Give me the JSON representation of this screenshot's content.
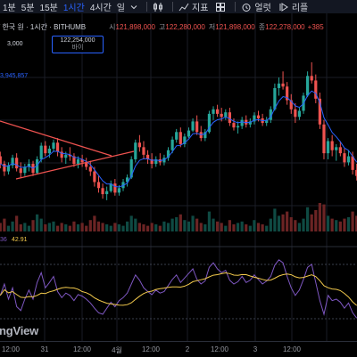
{
  "toolbar": {
    "timeframes": [
      {
        "label": "1분",
        "active": false
      },
      {
        "label": "5분",
        "active": false
      },
      {
        "label": "15분",
        "active": false
      },
      {
        "label": "1시간",
        "active": true
      },
      {
        "label": "4시간",
        "active": false
      },
      {
        "label": "일",
        "active": false
      }
    ],
    "indicators_label": "지표",
    "alert_label": "얼럿",
    "replay_label": "리플"
  },
  "symbol": {
    "title": "/ 한국 원 · 1시간 · BITHUMB",
    "open_label": "시",
    "open_value": "121,898,000",
    "high_label": "고",
    "high_value": "122,280,000",
    "low_label": "저",
    "low_value": "121,898,000",
    "close_label": "종",
    "close_value": "122,278,000",
    "change_value": "+385"
  },
  "order": {
    "price": "122,254,000",
    "side_label": "바이",
    "left_value": "3,000"
  },
  "price_tag": "3,945,857",
  "rsi": {
    "value_a": "36",
    "value_b": "42.91"
  },
  "watermark": "ngView",
  "time_axis": [
    "12:00",
    "31",
    "12:00",
    "4월",
    "12:00",
    "2",
    "12:00",
    "3",
    "12:00"
  ],
  "colors": {
    "up": "#26a69a",
    "down": "#ef5350",
    "accent": "#2962ff",
    "rsi_line": "#7e57c2",
    "rsi_ma": "#f2c94c"
  },
  "chart_data": {
    "type": "candlestick",
    "candles": [
      [
        0.6,
        0.63,
        0.52,
        0.55
      ],
      [
        0.55,
        0.57,
        0.47,
        0.5
      ],
      [
        0.5,
        0.56,
        0.48,
        0.54
      ],
      [
        0.54,
        0.61,
        0.52,
        0.59
      ],
      [
        0.59,
        0.62,
        0.5,
        0.52
      ],
      [
        0.52,
        0.56,
        0.46,
        0.49
      ],
      [
        0.49,
        0.55,
        0.47,
        0.53
      ],
      [
        0.53,
        0.58,
        0.5,
        0.55
      ],
      [
        0.55,
        0.57,
        0.47,
        0.49
      ],
      [
        0.49,
        0.6,
        0.48,
        0.58
      ],
      [
        0.58,
        0.69,
        0.56,
        0.67
      ],
      [
        0.67,
        0.7,
        0.6,
        0.62
      ],
      [
        0.62,
        0.67,
        0.59,
        0.65
      ],
      [
        0.65,
        0.71,
        0.63,
        0.69
      ],
      [
        0.69,
        0.72,
        0.6,
        0.63
      ],
      [
        0.63,
        0.66,
        0.56,
        0.59
      ],
      [
        0.59,
        0.63,
        0.55,
        0.61
      ],
      [
        0.61,
        0.66,
        0.57,
        0.6
      ],
      [
        0.6,
        0.62,
        0.53,
        0.55
      ],
      [
        0.55,
        0.6,
        0.52,
        0.58
      ],
      [
        0.58,
        0.61,
        0.53,
        0.56
      ],
      [
        0.56,
        0.59,
        0.51,
        0.53
      ],
      [
        0.53,
        0.57,
        0.47,
        0.5
      ],
      [
        0.5,
        0.53,
        0.4,
        0.43
      ],
      [
        0.43,
        0.47,
        0.36,
        0.39
      ],
      [
        0.39,
        0.42,
        0.32,
        0.35
      ],
      [
        0.35,
        0.4,
        0.31,
        0.37
      ],
      [
        0.37,
        0.44,
        0.36,
        0.42
      ],
      [
        0.42,
        0.45,
        0.34,
        0.36
      ],
      [
        0.36,
        0.41,
        0.34,
        0.39
      ],
      [
        0.39,
        0.45,
        0.37,
        0.43
      ],
      [
        0.43,
        0.48,
        0.4,
        0.46
      ],
      [
        0.46,
        0.6,
        0.45,
        0.58
      ],
      [
        0.58,
        0.71,
        0.56,
        0.69
      ],
      [
        0.69,
        0.74,
        0.63,
        0.66
      ],
      [
        0.66,
        0.7,
        0.58,
        0.61
      ],
      [
        0.61,
        0.64,
        0.55,
        0.58
      ],
      [
        0.58,
        0.62,
        0.52,
        0.55
      ],
      [
        0.55,
        0.6,
        0.53,
        0.58
      ],
      [
        0.58,
        0.62,
        0.54,
        0.56
      ],
      [
        0.56,
        0.61,
        0.54,
        0.59
      ],
      [
        0.59,
        0.66,
        0.57,
        0.64
      ],
      [
        0.64,
        0.73,
        0.62,
        0.71
      ],
      [
        0.71,
        0.78,
        0.69,
        0.76
      ],
      [
        0.76,
        0.79,
        0.66,
        0.68
      ],
      [
        0.68,
        0.75,
        0.66,
        0.73
      ],
      [
        0.73,
        0.79,
        0.72,
        0.77
      ],
      [
        0.77,
        0.85,
        0.76,
        0.83
      ],
      [
        0.83,
        0.87,
        0.74,
        0.76
      ],
      [
        0.76,
        0.8,
        0.7,
        0.72
      ],
      [
        0.72,
        0.78,
        0.7,
        0.76
      ],
      [
        0.76,
        0.9,
        0.75,
        0.88
      ],
      [
        0.88,
        0.93,
        0.84,
        0.91
      ],
      [
        0.91,
        0.94,
        0.86,
        0.88
      ],
      [
        0.88,
        0.92,
        0.83,
        0.86
      ],
      [
        0.86,
        0.91,
        0.84,
        0.89
      ],
      [
        0.89,
        0.92,
        0.8,
        0.82
      ],
      [
        0.82,
        0.85,
        0.77,
        0.79
      ],
      [
        0.79,
        0.83,
        0.75,
        0.8
      ],
      [
        0.8,
        0.86,
        0.78,
        0.84
      ],
      [
        0.84,
        0.87,
        0.79,
        0.81
      ],
      [
        0.81,
        0.85,
        0.79,
        0.83
      ],
      [
        0.83,
        0.89,
        0.81,
        0.87
      ],
      [
        0.87,
        0.9,
        0.83,
        0.85
      ],
      [
        0.85,
        0.88,
        0.8,
        0.82
      ],
      [
        0.82,
        0.86,
        0.8,
        0.84
      ],
      [
        0.84,
        0.93,
        0.82,
        0.91
      ],
      [
        0.91,
        1.08,
        0.9,
        1.05
      ],
      [
        1.05,
        1.12,
        1.0,
        1.08
      ],
      [
        1.08,
        1.16,
        1.04,
        1.06
      ],
      [
        1.06,
        1.09,
        0.94,
        0.97
      ],
      [
        0.97,
        1.01,
        0.88,
        0.91
      ],
      [
        0.91,
        0.95,
        0.82,
        0.86
      ],
      [
        0.86,
        0.92,
        0.84,
        0.9
      ],
      [
        0.9,
        1.02,
        0.88,
        1.0
      ],
      [
        1.0,
        1.16,
        0.99,
        1.13
      ],
      [
        1.13,
        1.22,
        1.08,
        1.1
      ],
      [
        1.1,
        1.14,
        0.95,
        0.98
      ],
      [
        0.98,
        1.02,
        0.78,
        0.81
      ],
      [
        0.81,
        0.84,
        0.58,
        0.62
      ],
      [
        0.62,
        0.72,
        0.58,
        0.7
      ],
      [
        0.7,
        0.74,
        0.6,
        0.64
      ],
      [
        0.64,
        0.68,
        0.57,
        0.66
      ],
      [
        0.66,
        0.7,
        0.6,
        0.62
      ],
      [
        0.62,
        0.65,
        0.53,
        0.56
      ],
      [
        0.56,
        0.64,
        0.54,
        0.6
      ],
      [
        0.6,
        0.63,
        0.48,
        0.51
      ],
      [
        0.51,
        0.55,
        0.44,
        0.47
      ]
    ],
    "volume": [
      0.3,
      0.45,
      0.2,
      0.35,
      0.55,
      0.25,
      0.3,
      0.2,
      0.4,
      0.6,
      0.45,
      0.25,
      0.3,
      0.35,
      0.2,
      0.3,
      0.25,
      0.2,
      0.35,
      0.25,
      0.3,
      0.2,
      0.4,
      0.55,
      0.35,
      0.3,
      0.25,
      0.2,
      0.3,
      0.25,
      0.2,
      0.35,
      0.55,
      0.45,
      0.3,
      0.25,
      0.2,
      0.3,
      0.25,
      0.2,
      0.35,
      0.3,
      0.45,
      0.5,
      0.6,
      0.4,
      0.35,
      0.55,
      0.45,
      0.3,
      0.25,
      0.7,
      0.45,
      0.35,
      0.3,
      0.2,
      0.4,
      0.25,
      0.3,
      0.35,
      0.25,
      0.2,
      0.4,
      0.3,
      0.25,
      0.2,
      0.45,
      0.8,
      0.55,
      0.6,
      0.7,
      0.5,
      0.4,
      0.3,
      0.45,
      0.85,
      0.6,
      0.75,
      1.0,
      0.95,
      0.55,
      0.45,
      0.4,
      0.35,
      0.45,
      0.5,
      0.7,
      0.55
    ],
    "rsi": [
      0.45,
      0.6,
      0.4,
      0.55,
      0.3,
      0.25,
      0.4,
      0.52,
      0.4,
      0.62,
      0.75,
      0.55,
      0.62,
      0.7,
      0.5,
      0.42,
      0.48,
      0.45,
      0.38,
      0.46,
      0.44,
      0.4,
      0.35,
      0.28,
      0.22,
      0.2,
      0.28,
      0.36,
      0.3,
      0.38,
      0.42,
      0.48,
      0.6,
      0.72,
      0.65,
      0.55,
      0.5,
      0.46,
      0.52,
      0.48,
      0.5,
      0.58,
      0.66,
      0.72,
      0.62,
      0.68,
      0.74,
      0.8,
      0.66,
      0.6,
      0.64,
      0.82,
      0.88,
      0.8,
      0.75,
      0.78,
      0.65,
      0.6,
      0.63,
      0.7,
      0.62,
      0.65,
      0.72,
      0.66,
      0.6,
      0.64,
      0.7,
      0.85,
      0.92,
      0.88,
      0.7,
      0.55,
      0.45,
      0.52,
      0.66,
      0.82,
      0.86,
      0.62,
      0.38,
      0.2,
      0.45,
      0.38,
      0.4,
      0.36,
      0.28,
      0.35,
      0.22,
      0.15
    ]
  }
}
